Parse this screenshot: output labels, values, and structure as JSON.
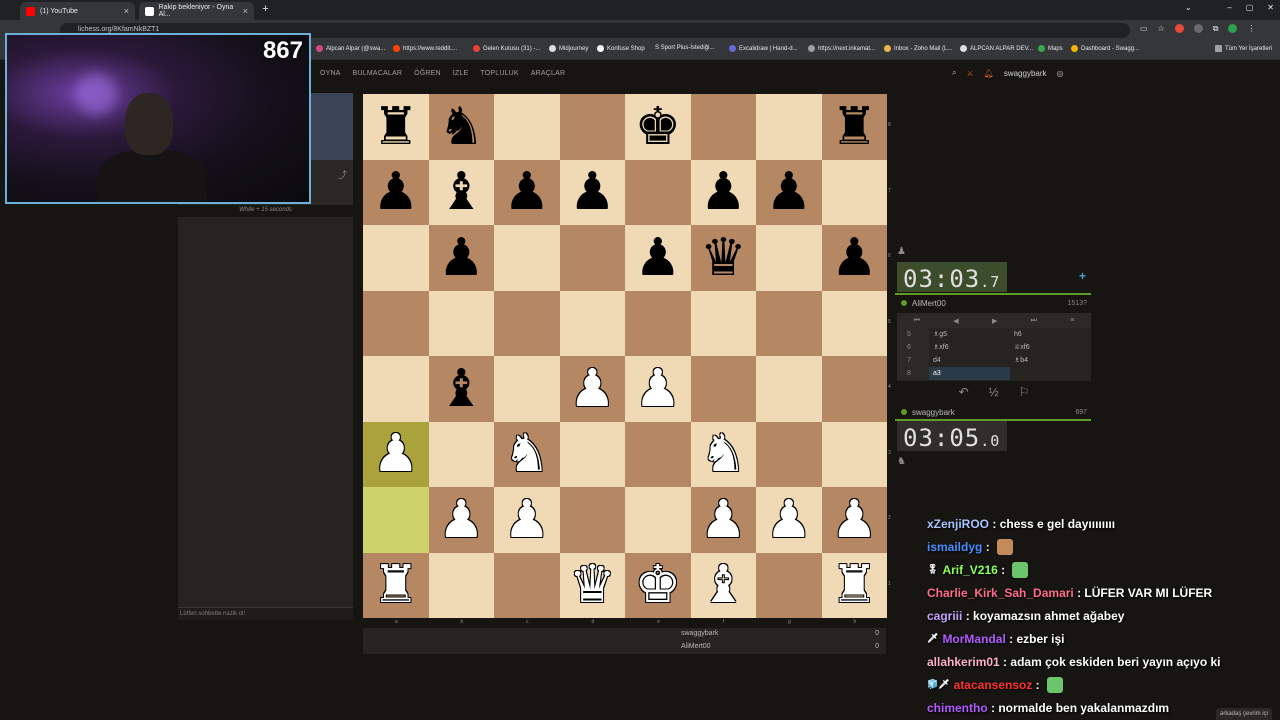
{
  "browser": {
    "tabs": [
      {
        "title": "(1) YouTube",
        "favicon": "youtube-icon",
        "color": "#ff0000"
      },
      {
        "title": "Rakip bekleniyor - Oyna Al...",
        "favicon": "lichess-icon",
        "color": "#ffffff"
      }
    ],
    "new_tab": "+",
    "url": "lichess.org/8KfamNkBZT1",
    "bookmarks": [
      "Alpcan Alpar (@swa...",
      "https://www.reddit....",
      "Gelen Kutusu (31) -...",
      "Midjourney",
      "Konfuse Shop",
      "S Sport Plus-İstediği...",
      "Excalidraw | Hand-d...",
      "https://next.inkamat...",
      "Inbox - Zoho Mail (L...",
      "ALPCAN ALPAR DEV...",
      "Maps",
      "Dashboard - Swagg...",
      "Tüm Yer İşaretleri"
    ]
  },
  "site": {
    "nav": [
      "OYNA",
      "BULMACALAR",
      "ÖĞREN",
      "İZLE",
      "TOPLULUK",
      "ARAÇLAR"
    ],
    "username": "swaggybark"
  },
  "left": {
    "time_control": "White + 15 seconds",
    "chat_placeholder": "Lütfen sohbette nazik ol!"
  },
  "webcam": {
    "viewer_count": "867"
  },
  "board": {
    "ranks": [
      "8",
      "7",
      "6",
      "5",
      "4",
      "3",
      "2",
      "1"
    ],
    "files": [
      "a",
      "b",
      "c",
      "d",
      "e",
      "f",
      "g",
      "h"
    ],
    "position": [
      [
        "bR",
        "bN",
        "",
        "",
        "bK",
        "",
        "",
        "bR"
      ],
      [
        "bP",
        "bB",
        "bP",
        "bP",
        "",
        "bP",
        "bP",
        ""
      ],
      [
        "",
        "bP",
        "",
        "",
        "bP",
        "bQ",
        "",
        "bP"
      ],
      [
        "",
        "",
        "",
        "",
        "",
        "",
        "",
        ""
      ],
      [
        "",
        "bB",
        "",
        "wP",
        "wP",
        "",
        "",
        ""
      ],
      [
        "wP",
        "",
        "wN",
        "",
        "",
        "wN",
        "",
        ""
      ],
      [
        "",
        "wP",
        "wP",
        "",
        "",
        "wP",
        "wP",
        "wP"
      ],
      [
        "wR",
        "",
        "",
        "wQ",
        "wK",
        "wB",
        "",
        "wR"
      ]
    ],
    "highlight": [
      "a3",
      "a2"
    ]
  },
  "material": [
    {
      "name": "swaggybark",
      "score": "0"
    },
    {
      "name": "AliMert00",
      "score": "0"
    }
  ],
  "opponent": {
    "name": "AliMert00",
    "rating": "1513?",
    "clock_main": "03:03",
    "clock_tenth": ".7"
  },
  "me": {
    "name": "swaggybark",
    "rating": "697",
    "clock_main": "03:05",
    "clock_tenth": ".0"
  },
  "moves": [
    {
      "n": "5",
      "white": "♗g5",
      "black": "h6"
    },
    {
      "n": "6",
      "white": "♗xf6",
      "black": "♕xf6"
    },
    {
      "n": "7",
      "white": "d4",
      "black": "♗b4"
    },
    {
      "n": "8",
      "white": "a3",
      "black": ""
    }
  ],
  "move_controls": [
    "⏮",
    "◀",
    "▶",
    "⏭",
    "≡"
  ],
  "game_controls": [
    "↶",
    "½",
    "⚐"
  ],
  "stream_chat": [
    {
      "user": "xZenjiROO",
      "color": "#a9c3ff",
      "text": "chess e gel dayıııııııı",
      "badge": "",
      "emote": ""
    },
    {
      "user": "ismaildyg",
      "color": "#4a8cff",
      "text": "",
      "badge": "",
      "emote": "#c58a5a"
    },
    {
      "user": "Arif_V216",
      "color": "#8cff5a",
      "text": "",
      "badge": "🎖",
      "emote": "#6cc56c"
    },
    {
      "user": "Charlie_Kirk_Sah_Damari",
      "color": "#ff6b8a",
      "text": "LÜFER VAR MI LÜFER",
      "badge": "",
      "emote": ""
    },
    {
      "user": "cagriii",
      "color": "#c8a0ff",
      "text": "koyamazsın ahmet ağabey",
      "badge": "",
      "emote": ""
    },
    {
      "user": "MorMandal",
      "color": "#b05aff",
      "text": "ezber işi",
      "badge": "🗡",
      "emote": ""
    },
    {
      "user": "allahkerim01",
      "color": "#ffb0c8",
      "text": "adam çok eskiden beri yayın açıyo ki",
      "badge": "",
      "emote": ""
    },
    {
      "user": "atacansensoz",
      "color": "#ff3030",
      "text": "",
      "badge": "🧊🗡",
      "emote": "#6cc56c"
    },
    {
      "user": "chimentho",
      "color": "#b05aff",
      "text": "normalde ben yakalanmazdım",
      "badge": "",
      "emote": ""
    }
  ],
  "friends_online": "arkadaş çevrim içi"
}
